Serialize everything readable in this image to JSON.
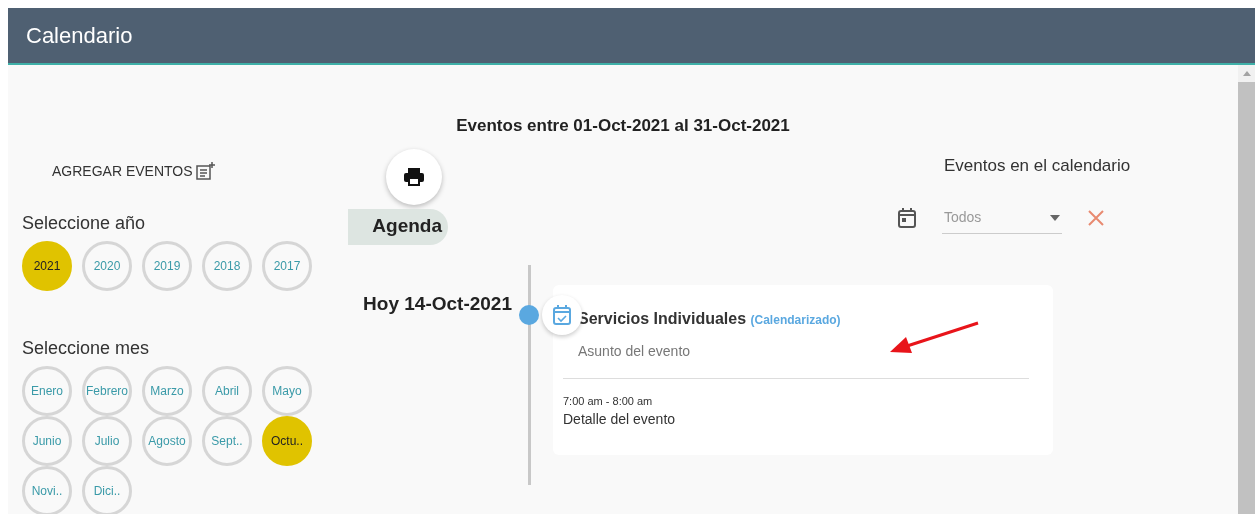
{
  "header": {
    "title": "Calendario"
  },
  "range_title": "Eventos entre 01-Oct-2021 al 31-Oct-2021",
  "add_events": "AGREGAR EVENTOS",
  "year_section": {
    "label": "Seleccione año",
    "years": [
      {
        "label": "2021",
        "selected": true
      },
      {
        "label": "2020",
        "selected": false
      },
      {
        "label": "2019",
        "selected": false
      },
      {
        "label": "2018",
        "selected": false
      },
      {
        "label": "2017",
        "selected": false
      }
    ]
  },
  "month_section": {
    "label": "Seleccione mes",
    "months": [
      {
        "label": "Enero",
        "selected": false
      },
      {
        "label": "Febrero",
        "selected": false
      },
      {
        "label": "Marzo",
        "selected": false
      },
      {
        "label": "Abril",
        "selected": false
      },
      {
        "label": "Mayo",
        "selected": false
      },
      {
        "label": "Junio",
        "selected": false
      },
      {
        "label": "Julio",
        "selected": false
      },
      {
        "label": "Agosto",
        "selected": false
      },
      {
        "label": "Sept..",
        "selected": false
      },
      {
        "label": "Octu..",
        "selected": true
      },
      {
        "label": "Novi..",
        "selected": false
      },
      {
        "label": "Dici..",
        "selected": false
      }
    ]
  },
  "agenda_label": "Agenda",
  "filter": {
    "title": "Eventos en el calendario",
    "placeholder": "Todos"
  },
  "timeline": [
    {
      "date": "Hoy 14-Oct-2021",
      "title": "Servicios Individuales",
      "status": "(Calendarizado)",
      "subject": "Asunto del evento",
      "time": "7:00 am - 8:00 am",
      "detail": "Detalle del evento"
    }
  ]
}
